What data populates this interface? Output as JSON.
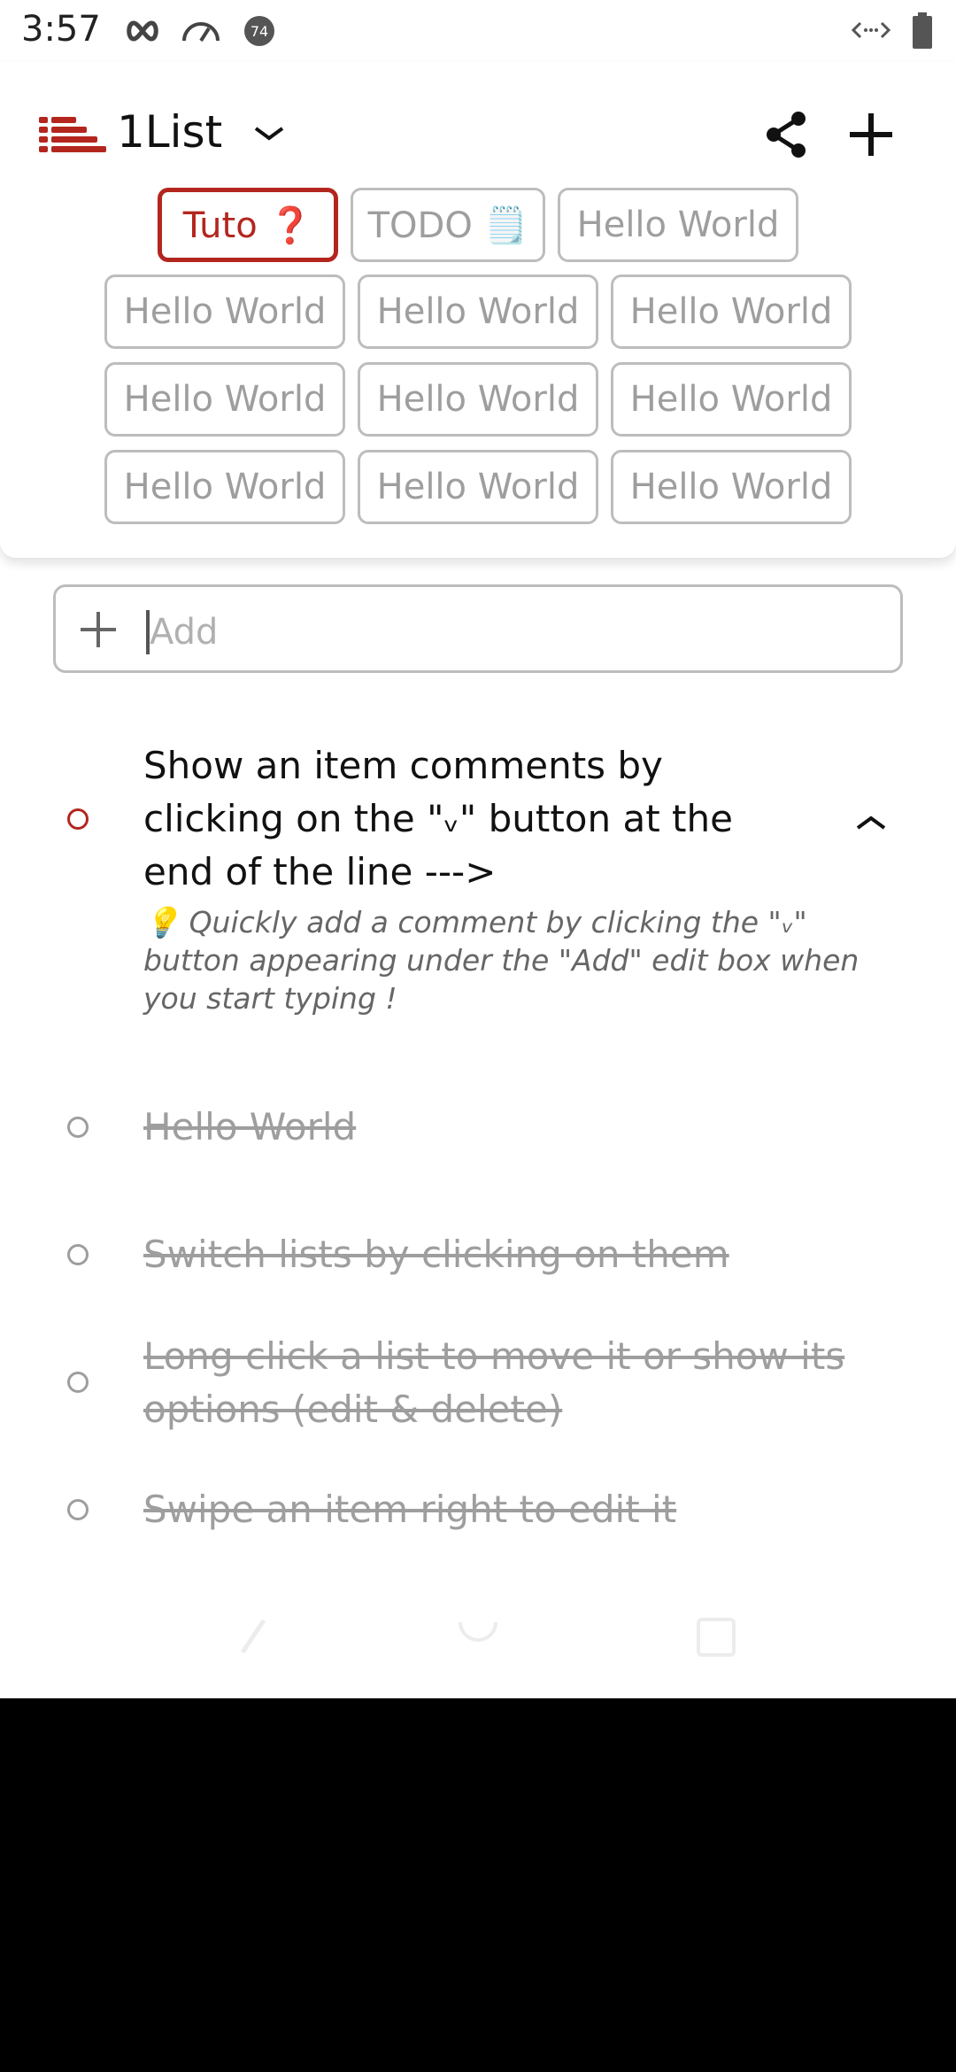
{
  "status_bar": {
    "time": "3:57",
    "badge_number": "74"
  },
  "header": {
    "title": "1List",
    "tabs": [
      {
        "label": "Tuto ❓",
        "active": true
      },
      {
        "label": "TODO 🗒️",
        "active": false
      },
      {
        "label": "Hello World",
        "active": false
      },
      {
        "label": "Hello World",
        "active": false
      },
      {
        "label": "Hello World",
        "active": false
      },
      {
        "label": "Hello World",
        "active": false
      },
      {
        "label": "Hello World",
        "active": false
      },
      {
        "label": "Hello World",
        "active": false
      },
      {
        "label": "Hello World",
        "active": false
      },
      {
        "label": "Hello World",
        "active": false
      },
      {
        "label": "Hello World",
        "active": false
      },
      {
        "label": "Hello World",
        "active": false
      }
    ]
  },
  "add_field": {
    "placeholder": "Add",
    "value": ""
  },
  "items": [
    {
      "text_line1": "Show an item comments by",
      "text_line2": "clicking on the \"ᵥ\" button at the",
      "text_line3": "end of the line --->",
      "comment": "💡 Quickly add a comment by clicking the \"ᵥ\" button appearing under the \"Add\" edit box when you start typing !",
      "done": false
    },
    {
      "text": "Hello World",
      "done": true
    },
    {
      "text": "Switch lists by clicking on them",
      "done": true
    },
    {
      "text_line1": "Long click a list to move it or show its",
      "text_line2": "options (edit & delete)",
      "done": true
    },
    {
      "text": "Swipe an item right to edit it",
      "done": true
    }
  ],
  "colors": {
    "accent": "#b3261e",
    "chip_border": "#bdbdbd",
    "muted_text": "#9e9e9e"
  },
  "icons": {
    "logo": "list-lines-icon",
    "share": "share-icon",
    "add": "plus-icon",
    "title_dropdown": "chevron-down-icon",
    "expand": "chevron-up-icon"
  }
}
